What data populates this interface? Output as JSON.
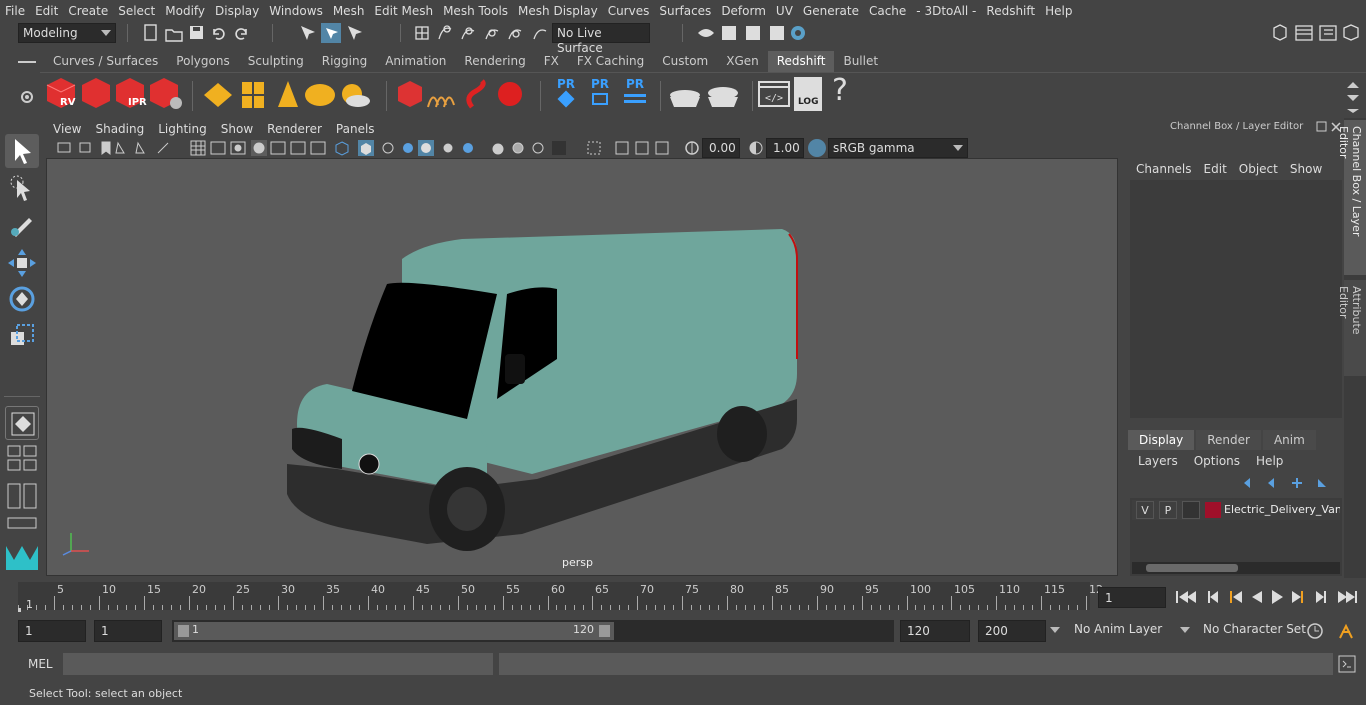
{
  "menubar": [
    "File",
    "Edit",
    "Create",
    "Select",
    "Modify",
    "Display",
    "Windows",
    "Mesh",
    "Edit Mesh",
    "Mesh Tools",
    "Mesh Display",
    "Curves",
    "Surfaces",
    "Deform",
    "UV",
    "Generate",
    "Cache",
    "- 3DtoAll -",
    "Redshift",
    "Help"
  ],
  "status": {
    "mode": "Modeling",
    "live_surface": "No Live Surface"
  },
  "shelf_tabs": [
    "Curves / Surfaces",
    "Polygons",
    "Sculpting",
    "Rigging",
    "Animation",
    "Rendering",
    "FX",
    "FX Caching",
    "Custom",
    "XGen",
    "Redshift",
    "Bullet"
  ],
  "shelf_active": "Redshift",
  "shelf_labels": {
    "rv": "RV",
    "ipr": "IPR",
    "pr1": "PR",
    "pr2": "PR",
    "pr3": "PR",
    "log": "LOG",
    "help": "?"
  },
  "viewport_menu": [
    "View",
    "Shading",
    "Lighting",
    "Show",
    "Renderer",
    "Panels"
  ],
  "viewport_tb": {
    "exposure": "0.00",
    "gamma": "1.00",
    "colorspace": "sRGB gamma"
  },
  "camera_label": "persp",
  "channel_box": {
    "title": "Channel Box / Layer Editor",
    "menus": [
      "Channels",
      "Edit",
      "Object",
      "Show"
    ]
  },
  "layer_editor": {
    "tabs": [
      "Display",
      "Render",
      "Anim"
    ],
    "active_tab": "Display",
    "menus": [
      "Layers",
      "Options",
      "Help"
    ],
    "layer": {
      "v": "V",
      "p": "P",
      "name": "Electric_Delivery_Van_S"
    }
  },
  "side_tabs": [
    "Channel Box / Layer Editor",
    "Attribute Editor"
  ],
  "timeline": {
    "ticks": [
      "5",
      "10",
      "15",
      "20",
      "25",
      "30",
      "35",
      "40",
      "45",
      "50",
      "55",
      "60",
      "65",
      "70",
      "75",
      "80",
      "85",
      "90",
      "95",
      "100",
      "105",
      "110",
      "115",
      "12"
    ],
    "start_marker": "1",
    "current_frame": "1"
  },
  "range": {
    "start": "1",
    "anim_start": "1",
    "slider_start": "1",
    "slider_end": "120",
    "end": "120",
    "anim_end": "200",
    "anim_layer": "No Anim Layer",
    "character_set": "No Character Set"
  },
  "mel": {
    "label": "MEL"
  },
  "help_line": "Select Tool: select an object",
  "colors": {
    "accent": "#5285a6",
    "van_body": "#6fa69c",
    "van_lower": "#2d2d2d",
    "layer_color": "#a0102a"
  }
}
